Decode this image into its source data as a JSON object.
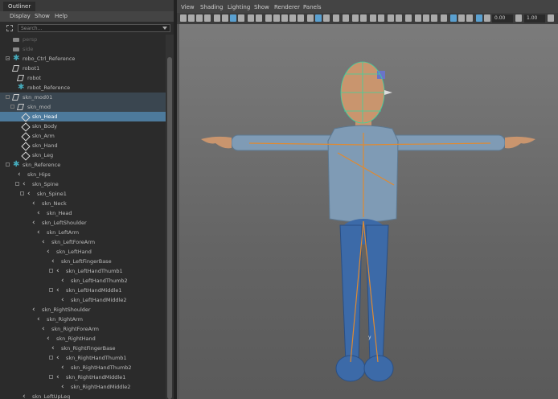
{
  "outliner": {
    "tab": "Outliner",
    "menus": [
      "Display",
      "Show",
      "Help"
    ],
    "search_placeholder": "Search...",
    "rows": [
      {
        "label": "persp",
        "indent": 0,
        "icon": "camera-icon",
        "state": "dim"
      },
      {
        "label": "side",
        "indent": 0,
        "icon": "camera-icon",
        "state": "dim"
      },
      {
        "label": "robo_Ctrl_Reference",
        "indent": 0,
        "icon": "reference-icon",
        "exp": "plus",
        "state": "normal"
      },
      {
        "label": "robot1",
        "indent": 0,
        "icon": "mesh-icon",
        "state": "normal"
      },
      {
        "label": "robot",
        "indent": 1,
        "icon": "mesh-icon",
        "state": "normal"
      },
      {
        "label": "robot_Reference",
        "indent": 1,
        "icon": "reference-icon",
        "state": "normal"
      },
      {
        "label": "skn_mod01",
        "indent": 0,
        "icon": "mesh-icon",
        "exp": "minus",
        "state": "dark"
      },
      {
        "label": "skn_mod",
        "indent": 1,
        "icon": "mesh-icon",
        "exp": "minus",
        "state": "dark"
      },
      {
        "label": "skn_Head",
        "indent": 2,
        "icon": "shape-icon",
        "state": "selected"
      },
      {
        "label": "skn_Body",
        "indent": 2,
        "icon": "shape-icon",
        "state": "normal"
      },
      {
        "label": "skn_Arm",
        "indent": 2,
        "icon": "shape-icon",
        "state": "normal"
      },
      {
        "label": "skn_Hand",
        "indent": 2,
        "icon": "shape-icon",
        "state": "normal"
      },
      {
        "label": "skn_Leg",
        "indent": 2,
        "icon": "shape-icon",
        "state": "normal"
      },
      {
        "label": "skn_Reference",
        "indent": 0,
        "icon": "reference-icon",
        "exp": "minus",
        "state": "normal"
      },
      {
        "label": "skn_Hips",
        "indent": 1,
        "icon": "joint-icon",
        "state": "normal"
      },
      {
        "label": "skn_Spine",
        "indent": 2,
        "icon": "joint-icon",
        "exp": "minus",
        "state": "normal"
      },
      {
        "label": "skn_Spine1",
        "indent": 3,
        "icon": "joint-icon",
        "exp": "minus",
        "state": "normal"
      },
      {
        "label": "skn_Neck",
        "indent": 4,
        "icon": "joint-icon",
        "state": "normal"
      },
      {
        "label": "skn_Head",
        "indent": 5,
        "icon": "joint-icon",
        "state": "normal"
      },
      {
        "label": "skn_LeftShoulder",
        "indent": 4,
        "icon": "joint-icon",
        "state": "normal"
      },
      {
        "label": "skn_LeftArm",
        "indent": 5,
        "icon": "joint-icon",
        "state": "normal"
      },
      {
        "label": "skn_LeftForeArm",
        "indent": 6,
        "icon": "joint-icon",
        "state": "normal"
      },
      {
        "label": "skn_LeftHand",
        "indent": 7,
        "icon": "joint-icon",
        "state": "normal"
      },
      {
        "label": "skn_LeftFingerBase",
        "indent": 8,
        "icon": "joint-icon",
        "state": "normal"
      },
      {
        "label": "skn_LeftHandThumb1",
        "indent": 9,
        "icon": "joint-icon",
        "exp": "minus",
        "state": "normal"
      },
      {
        "label": "skn_LeftHandThumb2",
        "indent": 10,
        "icon": "joint-icon",
        "state": "normal"
      },
      {
        "label": "skn_LeftHandMiddle1",
        "indent": 9,
        "icon": "joint-icon",
        "exp": "minus",
        "state": "normal"
      },
      {
        "label": "skn_LeftHandMiddle2",
        "indent": 10,
        "icon": "joint-icon",
        "state": "normal"
      },
      {
        "label": "skn_RightShoulder",
        "indent": 4,
        "icon": "joint-icon",
        "state": "normal"
      },
      {
        "label": "skn_RightArm",
        "indent": 5,
        "icon": "joint-icon",
        "state": "normal"
      },
      {
        "label": "skn_RightForeArm",
        "indent": 6,
        "icon": "joint-icon",
        "state": "normal"
      },
      {
        "label": "skn_RightHand",
        "indent": 7,
        "icon": "joint-icon",
        "state": "normal"
      },
      {
        "label": "skn_RightFingerBase",
        "indent": 8,
        "icon": "joint-icon",
        "state": "normal"
      },
      {
        "label": "skn_RightHandThumb1",
        "indent": 9,
        "icon": "joint-icon",
        "exp": "minus",
        "state": "normal"
      },
      {
        "label": "skn_RightHandThumb2",
        "indent": 10,
        "icon": "joint-icon",
        "state": "normal"
      },
      {
        "label": "skn_RightHandMiddle1",
        "indent": 9,
        "icon": "joint-icon",
        "exp": "minus",
        "state": "normal"
      },
      {
        "label": "skn_RightHandMiddle2",
        "indent": 10,
        "icon": "joint-icon",
        "state": "normal"
      },
      {
        "label": "skn_LeftUpLeg",
        "indent": 2,
        "icon": "joint-icon",
        "state": "normal"
      }
    ]
  },
  "viewport": {
    "menus": [
      "View",
      "Shading",
      "Lighting",
      "Show",
      "Renderer",
      "Panels"
    ],
    "field_value_1": "0.00",
    "field_value_2": "1.00",
    "axis_label": "y",
    "colors": {
      "accent": "#5aa0d0",
      "skin": "#c9956e",
      "shirt": "#7f9bb5",
      "pants": "#3c6aa8",
      "joints": "#e08a30"
    }
  }
}
